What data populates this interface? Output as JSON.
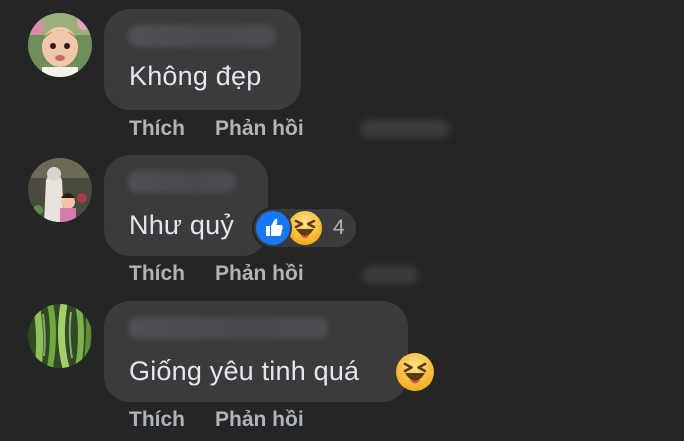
{
  "comments": [
    {
      "text": "Không đẹp",
      "like_label": "Thích",
      "reply_label": "Phản hồi"
    },
    {
      "text": "Như quỷ",
      "like_label": "Thích",
      "reply_label": "Phản hồi",
      "reactions": {
        "icons": [
          "like-icon",
          "haha-icon"
        ],
        "count": "4"
      }
    },
    {
      "text": "Giống yêu tinh quá",
      "emoji": "haha-emoji",
      "like_label": "Thích",
      "reply_label": "Phản hồi"
    }
  ],
  "colors": {
    "background": "#242526",
    "bubble": "#3a3b3c",
    "text": "#e4e6eb",
    "secondary_text": "#b0b3b8",
    "like_blue": "#1877f2",
    "haha_yellow": "#f7b125"
  }
}
